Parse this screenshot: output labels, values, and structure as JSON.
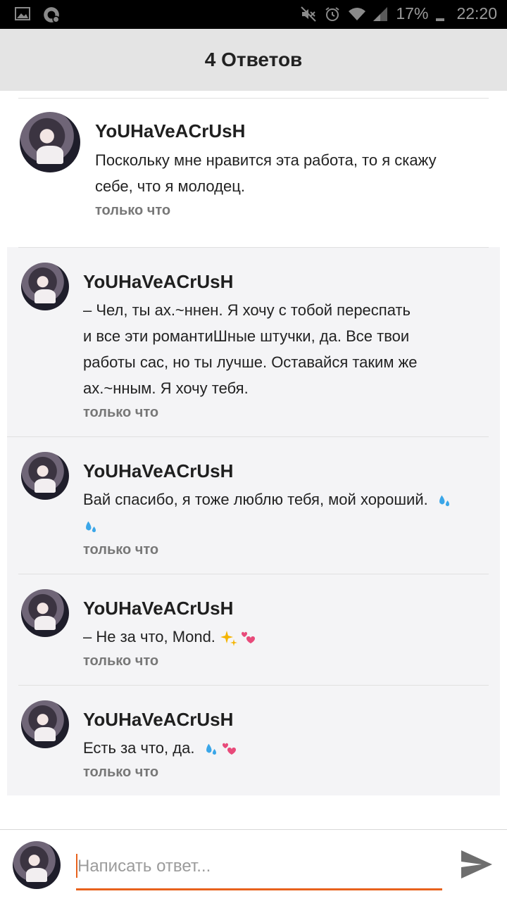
{
  "status_bar": {
    "battery": "17%",
    "time": "22:20",
    "left_icons": [
      "image-icon",
      "sync-icon"
    ],
    "right_icons": [
      "mute-icon",
      "alarm-icon",
      "wifi-icon",
      "signal-icon",
      "battery-icon"
    ]
  },
  "header": {
    "title": "4 Ответов"
  },
  "main_comment": {
    "author": "YoUHaVeACrUsH",
    "text_lines": [
      "Поскольку мне нравится эта работа, то я скажу",
      "себе, что я молодец."
    ],
    "time": "только что"
  },
  "replies": [
    {
      "author": "YoUHaVeACrUsH",
      "text_lines": [
        " – Чел, ты ах.~ннен. Я хочу с тобой переспать",
        "и все эти романтиШные штучки, да. Все твои",
        "работы сас, но ты лучше. Оставайся таким же",
        "ах.~нным. Я хочу тебя."
      ],
      "time": "только что"
    },
    {
      "author": "YoUHaVeACrUsH",
      "text_lines": [
        "Вай спасибо, я тоже люблю тебя, мой хороший."
      ],
      "time": "только что",
      "emojis": [
        "sweat-droplets-icon",
        "sweat-droplets-icon"
      ]
    },
    {
      "author": "YoUHaVeACrUsH",
      "text_lines": [
        " – Не за что, Mond."
      ],
      "time": "только что",
      "emojis": [
        "sparkles-icon",
        "two-hearts-icon"
      ]
    },
    {
      "author": "YoUHaVeACrUsH",
      "text_lines": [
        "Есть за что, да."
      ],
      "time": "только что",
      "emojis": [
        "sweat-droplets-icon",
        "two-hearts-icon"
      ]
    }
  ],
  "composer": {
    "placeholder": "Написать ответ..."
  },
  "colors": {
    "accent": "#e8621c",
    "header_bg": "#e4e4e4",
    "replies_bg": "#f4f4f6",
    "drop_blue": "#3aa6e8",
    "heart_pink": "#e84a7a"
  }
}
